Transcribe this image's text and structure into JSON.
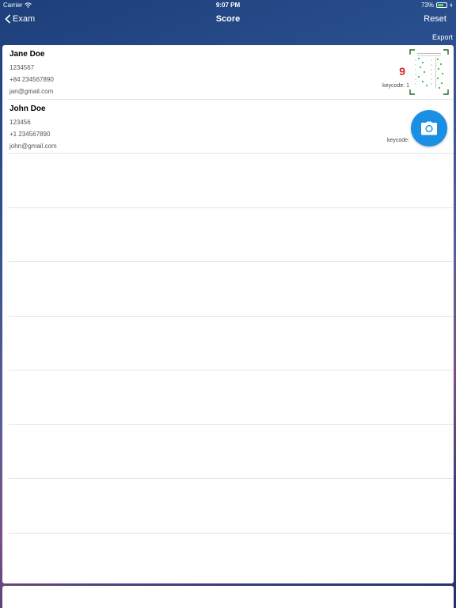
{
  "status": {
    "carrier": "Carrier",
    "time": "9:07 PM",
    "battery": "73%",
    "battery_level": 0.73
  },
  "nav": {
    "back_label": "Exam",
    "title": "Score",
    "reset_label": "Reset"
  },
  "toolbar": {
    "export_label": "Export"
  },
  "students": [
    {
      "name": "Jane Doe",
      "id": "1234567",
      "phone": "+84 234567890",
      "email": "jan@gmail.com",
      "score": "9",
      "keycode": "keycode: 1"
    },
    {
      "name": "John Doe",
      "id": "123456",
      "phone": "+1 234567890",
      "email": "john@gmail.com",
      "score": "",
      "keycode": "keycode:"
    }
  ],
  "colors": {
    "accent": "#1b8fe3",
    "score": "#d0281e",
    "answer_dot": "#2fbf3a"
  },
  "icons": {
    "back": "chevron-left-icon",
    "camera": "camera-icon",
    "wifi": "wifi-icon",
    "battery": "battery-icon"
  }
}
